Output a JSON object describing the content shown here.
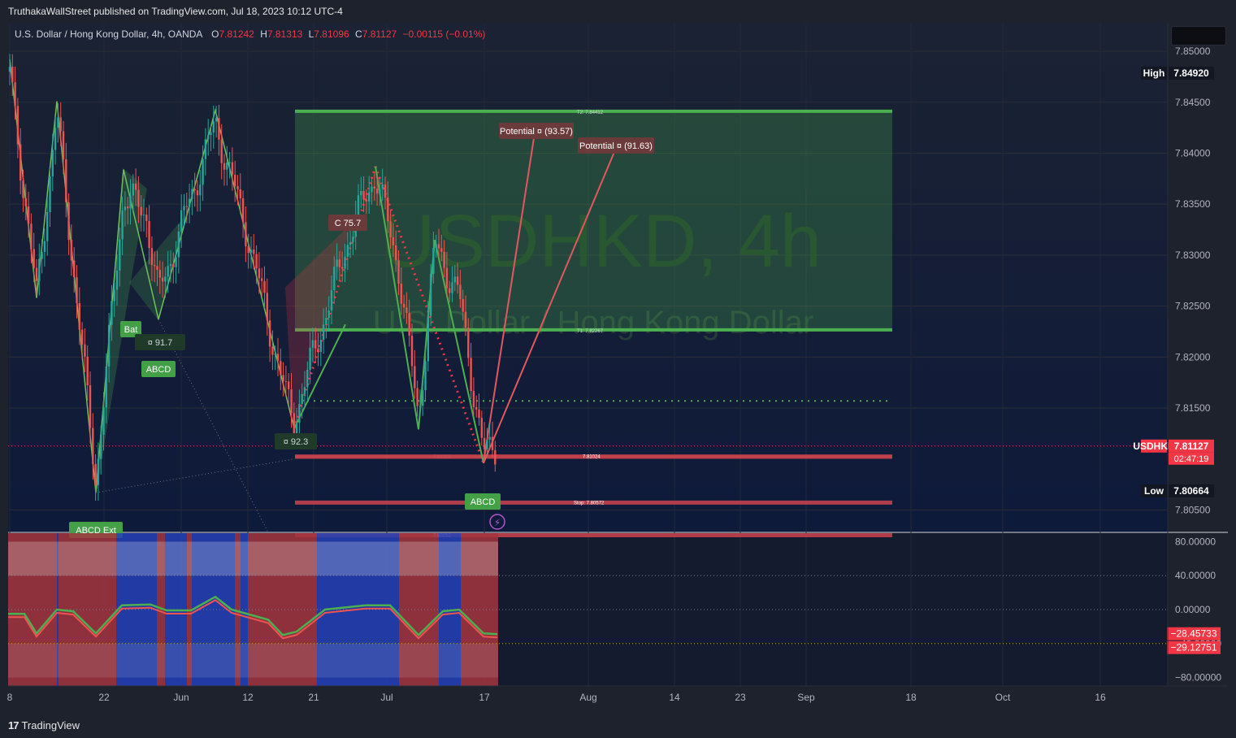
{
  "header": {
    "publisher_line": "TruthakaWallStreet published on TradingView.com, Jul 18, 2023 10:12 UTC-4"
  },
  "legend": {
    "symbol": "U.S. Dollar / Hong Kong Dollar, 4h, OANDA",
    "open_label": "O",
    "open": "7.81242",
    "high_label": "H",
    "high": "7.81313",
    "low_label": "L",
    "low": "7.81096",
    "close_label": "C",
    "close": "7.81127",
    "change": "−0.00115 (−0.01%)"
  },
  "watermark": {
    "ticker": "USDHKD, 4h",
    "name": "U.S. Dollar / Hong Kong Dollar"
  },
  "footer": {
    "logo_text": "TradingView",
    "logo_mark": "17"
  },
  "colors": {
    "background": "#131722",
    "green": "#4caf50",
    "red": "#f23645",
    "blue_band": "#2441b8",
    "text": "#d1d4dc"
  },
  "chart_data": {
    "type": "candlestick",
    "symbol": "USDHKD",
    "timeframe": "4h",
    "price_axis": {
      "ticks": [
        "7.85000",
        "7.84500",
        "7.84000",
        "7.83500",
        "7.83000",
        "7.82500",
        "7.82000",
        "7.81500",
        "7.80500"
      ],
      "ylim": [
        7.8028,
        7.8528
      ]
    },
    "time_axis": {
      "ticks": [
        "8",
        "22",
        "Jun",
        "12",
        "21",
        "Jul",
        "17",
        "Aug",
        "14",
        "23",
        "Sep",
        "18",
        "Oct",
        "16"
      ]
    },
    "price_labels": [
      {
        "name": "High",
        "value": "7.84920"
      },
      {
        "name": "USDHKD",
        "value": "7.81127",
        "countdown": "02:47:19"
      },
      {
        "name": "Low",
        "value": "7.80664"
      }
    ],
    "zone": {
      "t2_label": "T2:  7.84412",
      "t2": 7.84412,
      "t1_label": "T1:  7.82267",
      "t1": 7.82267
    },
    "lines": [
      {
        "label": "7.81023",
        "value": 7.81023
      },
      {
        "label": "7.81024",
        "value": 7.81024
      },
      {
        "label": "Stop:  7.80572",
        "value": 7.80572
      },
      {
        "label": "7.80252",
        "value": 7.80252
      }
    ],
    "dotted_level": 7.8157,
    "patterns": [
      {
        "label": "Bat"
      },
      {
        "label": "ABCD"
      },
      {
        "label": "ABCD"
      },
      {
        "label": "ABCD Ext"
      }
    ],
    "scores": [
      "¤ 91.7",
      "¤ 92.3",
      "Ϲ 75.7"
    ],
    "targets": [
      {
        "label": "Potential ¤ (93.57)"
      },
      {
        "label": "Potential ¤ (91.63)"
      }
    ],
    "oscillator": {
      "ticks": [
        "80.00000",
        "40.00000",
        "0.00000",
        "−40.00000",
        "−80.00000"
      ],
      "ylim": [
        -90,
        90
      ],
      "values": [
        "−28.45733",
        "−29.12751"
      ]
    }
  }
}
